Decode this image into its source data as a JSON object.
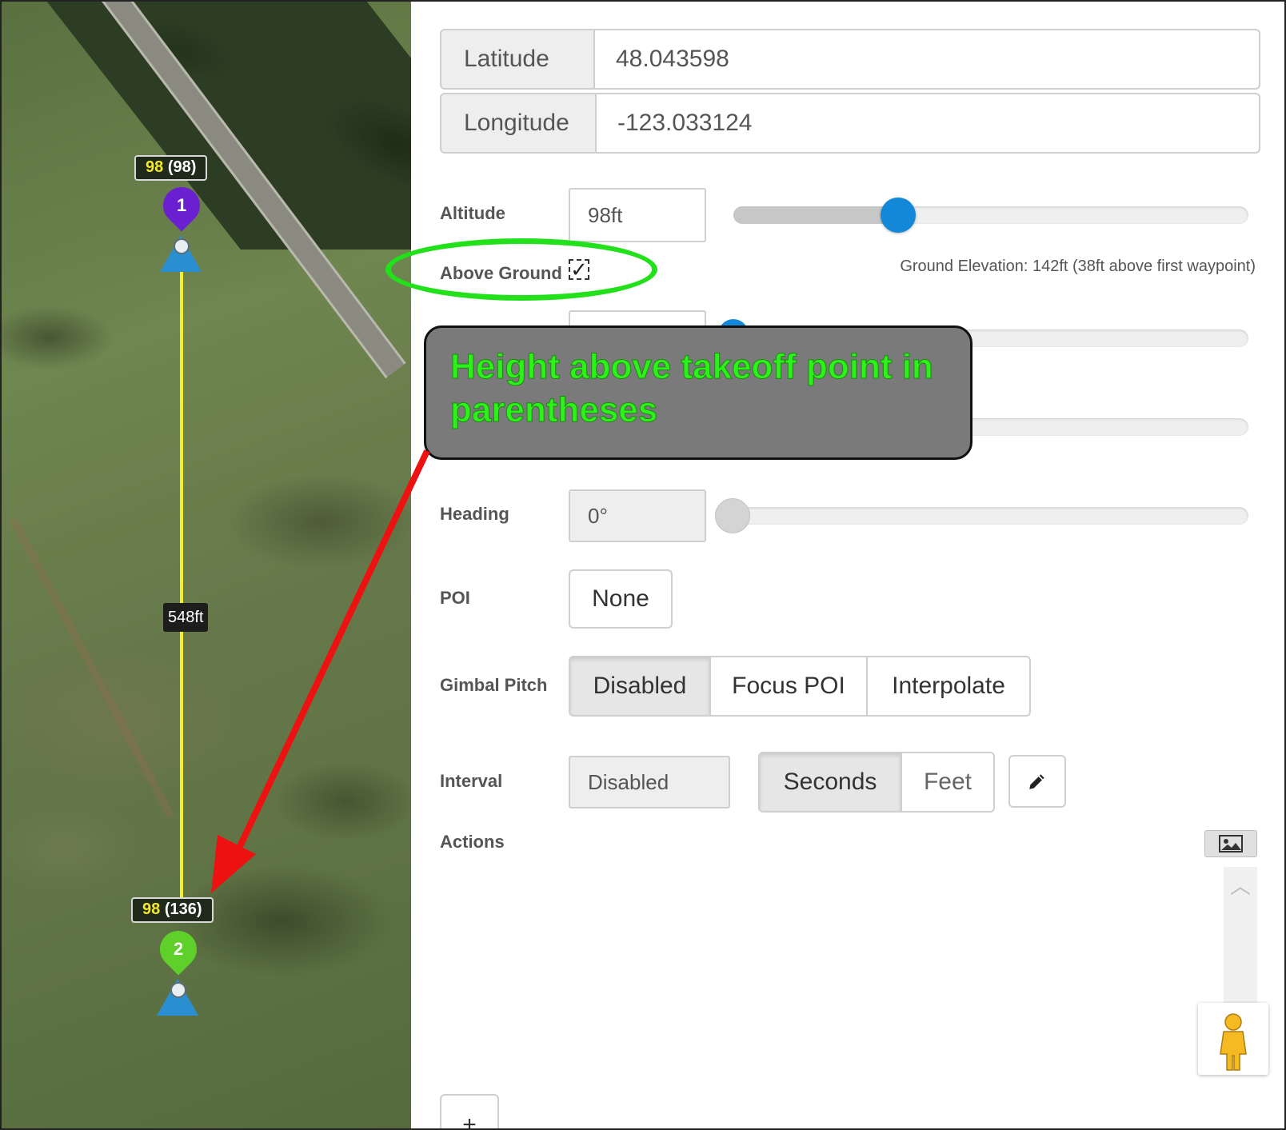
{
  "map": {
    "waypoints": [
      {
        "number": "1",
        "altitude": "98",
        "height_above_takeoff": "(98)",
        "color": "#6a1fd0"
      },
      {
        "number": "2",
        "altitude": "98",
        "height_above_takeoff": "(136)",
        "color": "#5fcf2a"
      }
    ],
    "segment_distance": "548ft",
    "route_color": "#f5ee2a"
  },
  "panel": {
    "latitude": {
      "label": "Latitude",
      "value": "48.043598"
    },
    "longitude": {
      "label": "Longitude",
      "value": "-123.033124"
    },
    "altitude": {
      "label": "Altitude",
      "value": "98ft",
      "slider_fraction": 0.32
    },
    "above_ground": {
      "label": "Above Ground",
      "checked": true,
      "check_glyph": "✓"
    },
    "ground_elevation": "Ground Elevation: 142ft (38ft above first waypoint)",
    "heading": {
      "label": "Heading",
      "value": "0°"
    },
    "poi": {
      "label": "POI",
      "button": "None"
    },
    "gimbal_pitch": {
      "label": "Gimbal Pitch",
      "options": [
        "Disabled",
        "Focus POI",
        "Interpolate"
      ],
      "selected": "Disabled"
    },
    "interval": {
      "label": "Interval",
      "value": "Disabled",
      "units": [
        "Seconds",
        "Feet"
      ],
      "selected_unit": "Seconds"
    },
    "actions": {
      "label": "Actions",
      "add_button": "+"
    }
  },
  "annotation": {
    "callout_text": "Height above takeoff point in parentheses",
    "ellipse_color": "#22e11a",
    "arrow_color": "#ee1111"
  },
  "colors": {
    "accent": "#1488d8",
    "knob_inactive": "#d4d4d4"
  }
}
